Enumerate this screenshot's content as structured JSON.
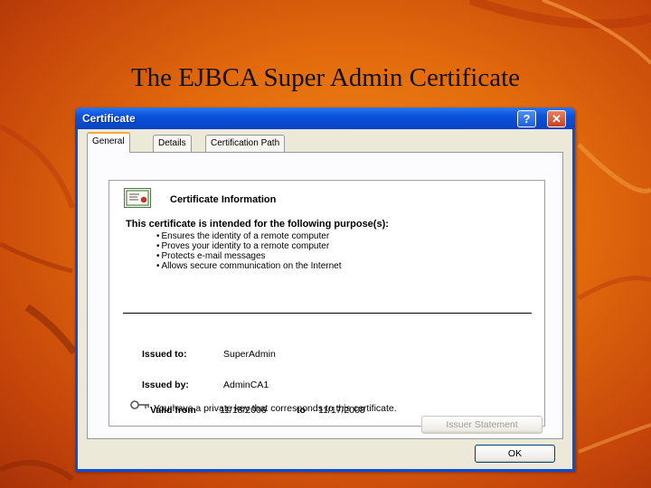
{
  "slide": {
    "title": "The EJBCA Super Admin Certificate"
  },
  "window": {
    "title": "Certificate",
    "help_glyph": "?",
    "close_glyph": "✕",
    "titlebar_color": "#0a52dc"
  },
  "tabs": [
    {
      "label": "General",
      "active": true
    },
    {
      "label": "Details",
      "active": false
    },
    {
      "label": "Certification Path",
      "active": false
    }
  ],
  "certificate": {
    "header": "Certificate Information",
    "purpose_heading": "This certificate is intended for the following purpose(s):",
    "purposes": [
      "Ensures the identity of a remote computer",
      "Proves your identity to a remote computer",
      "Protects e-mail messages",
      "Allows secure communication on the Internet"
    ],
    "issued_to_label": "Issued to:",
    "issued_to": "SuperAdmin",
    "issued_by_label": "Issued by:",
    "issued_by": "AdminCA1",
    "valid_from_label": "Valid from",
    "valid_from": "11/18/2006",
    "valid_to_label": "to",
    "valid_to": "11/17/2008",
    "private_key_note": "You have a private key that corresponds to this certificate."
  },
  "buttons": {
    "issuer_statement": "Issuer Statement",
    "ok": "OK"
  },
  "colors": {
    "background": "#e26a0c",
    "accent_tab": "#f3a93c"
  }
}
